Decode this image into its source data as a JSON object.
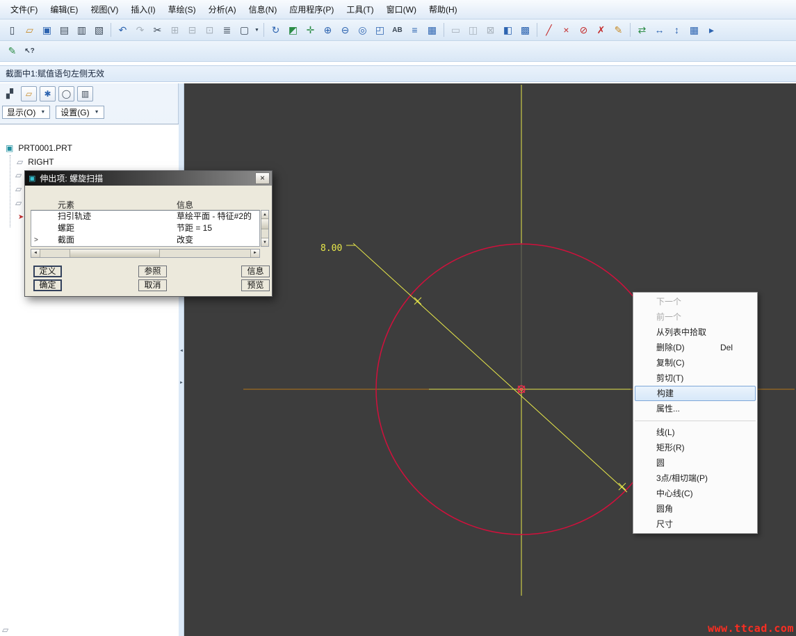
{
  "menubar": {
    "items": [
      "文件(F)",
      "编辑(E)",
      "视图(V)",
      "插入(I)",
      "草绘(S)",
      "分析(A)",
      "信息(N)",
      "应用程序(P)",
      "工具(T)",
      "窗口(W)",
      "帮助(H)"
    ]
  },
  "toolbar": {
    "row1": [
      "▯",
      "▱",
      "▣",
      "▤",
      "▥",
      "▧",
      "↶",
      "↷",
      "✂",
      "⊞",
      "⊟",
      "⊡",
      "≣",
      "▢",
      "↻",
      "◩",
      "✛",
      "⊕",
      "⊖",
      "◎",
      "◰",
      "AB",
      "≡",
      "▦",
      "▭",
      "◫",
      "⊠",
      "◧",
      "▩",
      "╱",
      "×",
      "⊘",
      "✗",
      "✎",
      "⇄",
      "↔",
      "↕",
      "▦",
      "▸"
    ],
    "row2": [
      "✎",
      "↖?"
    ]
  },
  "icons": {
    "dropdown": "▼",
    "close": "×",
    "up": "▲",
    "down": "▼",
    "left": "◄",
    "right": "►"
  },
  "message_bar": {
    "text": "截面中1:赋值语句左侧无效"
  },
  "left_panel": {
    "toolbar": [
      "▞",
      "▱",
      "✱",
      "◯",
      "▥"
    ],
    "show_label": "显示(O)",
    "settings_label": "设置(G)",
    "tree": [
      {
        "icon": "▣",
        "label": "PRT0001.PRT"
      },
      {
        "icon": "▱",
        "label": "RIGHT"
      }
    ],
    "stubs": [
      "▱",
      "▱",
      "▱",
      "➤"
    ],
    "corner_icon": "▱"
  },
  "dialog": {
    "title": "伸出项: 螺旋扫描",
    "table": {
      "headers": [
        "元素",
        "信息"
      ],
      "current_marker": ">",
      "rows": [
        {
          "element": "扫引轨迹",
          "info": "草绘平面 - 特征#2的"
        },
        {
          "element": "螺距",
          "info": "节距 = 15"
        },
        {
          "element": "截面",
          "info": "改变"
        }
      ]
    },
    "buttons": {
      "define": "定义",
      "refs": "参照",
      "info": "信息",
      "ok": "确定",
      "cancel": "取消",
      "preview": "预览"
    }
  },
  "context_menu": {
    "items": [
      {
        "label": "下一个"
      },
      {
        "label": "前一个"
      },
      {
        "label": "从列表中拾取"
      },
      {
        "label": "删除(D)",
        "shortcut": "Del"
      },
      {
        "label": "复制(C)"
      },
      {
        "label": "剪切(T)"
      },
      {
        "label": "构建"
      },
      {
        "label": "属性..."
      },
      {
        "label": "线(L)"
      },
      {
        "label": "矩形(R)"
      },
      {
        "label": "圆"
      },
      {
        "label": "3点/相切端(P)"
      },
      {
        "label": "中心线(C)"
      },
      {
        "label": "圆角"
      },
      {
        "label": "尺寸"
      }
    ]
  },
  "canvas": {
    "dimension_label": "8.00",
    "colors": {
      "background": "#3d3d3d",
      "entity": "#d2103c",
      "centerline": "#e8e84a",
      "reference": "#b87818",
      "point": "#ff2d4e"
    }
  },
  "watermark": "www.ttcad.com"
}
